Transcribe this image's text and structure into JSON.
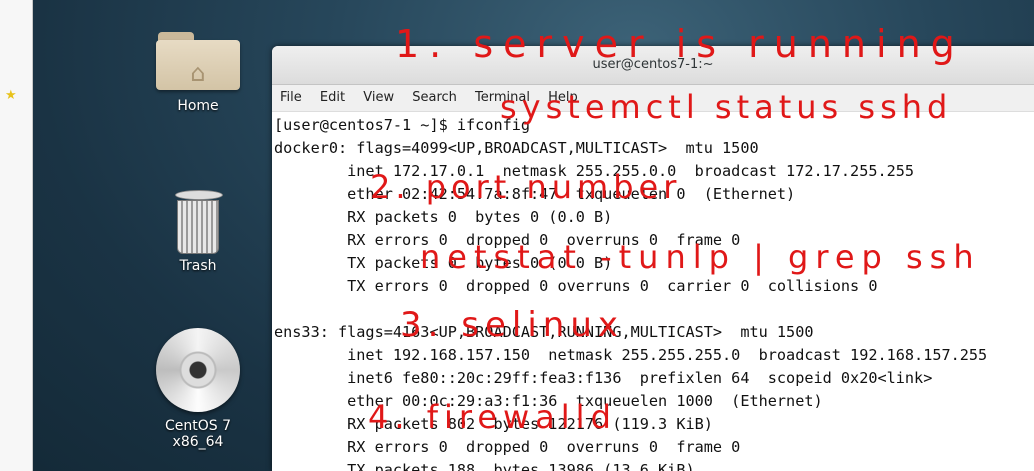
{
  "desktop": {
    "icons": [
      {
        "label": "Home",
        "icon": "folder-home-icon"
      },
      {
        "label": "Trash",
        "icon": "trash-icon"
      },
      {
        "label": "CentOS 7 x86_64",
        "icon": "dvd-disc-icon"
      }
    ]
  },
  "terminal": {
    "title": "user@centos7-1:~",
    "menu": [
      "File",
      "Edit",
      "View",
      "Search",
      "Terminal",
      "Help"
    ],
    "lines": [
      "[user@centos7-1 ~]$ ifconfig",
      "docker0: flags=4099<UP,BROADCAST,MULTICAST>  mtu 1500",
      "        inet 172.17.0.1  netmask 255.255.0.0  broadcast 172.17.255.255",
      "        ether 02:42:54:7a:8f:47  txqueuelen 0  (Ethernet)",
      "        RX packets 0  bytes 0 (0.0 B)",
      "        RX errors 0  dropped 0  overruns 0  frame 0",
      "        TX packets 0  bytes 0 (0.0 B)",
      "        TX errors 0  dropped 0 overruns 0  carrier 0  collisions 0",
      "",
      "ens33: flags=4163<UP,BROADCAST,RUNNING,MULTICAST>  mtu 1500",
      "        inet 192.168.157.150  netmask 255.255.255.0  broadcast 192.168.157.255",
      "        inet6 fe80::20c:29ff:fea3:f136  prefixlen 64  scopeid 0x20<link>",
      "        ether 00:0c:29:a3:f1:36  txqueuelen 1000  (Ethernet)",
      "        RX packets 802  bytes 122176 (119.3 KiB)",
      "        RX errors 0  dropped 0  overruns 0  frame 0",
      "        TX packets 188  bytes 13986 (13.6 KiB)"
    ]
  },
  "annotations": {
    "a1": "1. server is running",
    "a1b": "systemctl status sshd",
    "a2": "2. port number",
    "a2b": "netstat -tunlp | grep ssh",
    "a3": "3. selinux",
    "a4": "4. firewalld"
  },
  "colors": {
    "annotation": "#e01818",
    "desktop": "#1e3a4c"
  }
}
